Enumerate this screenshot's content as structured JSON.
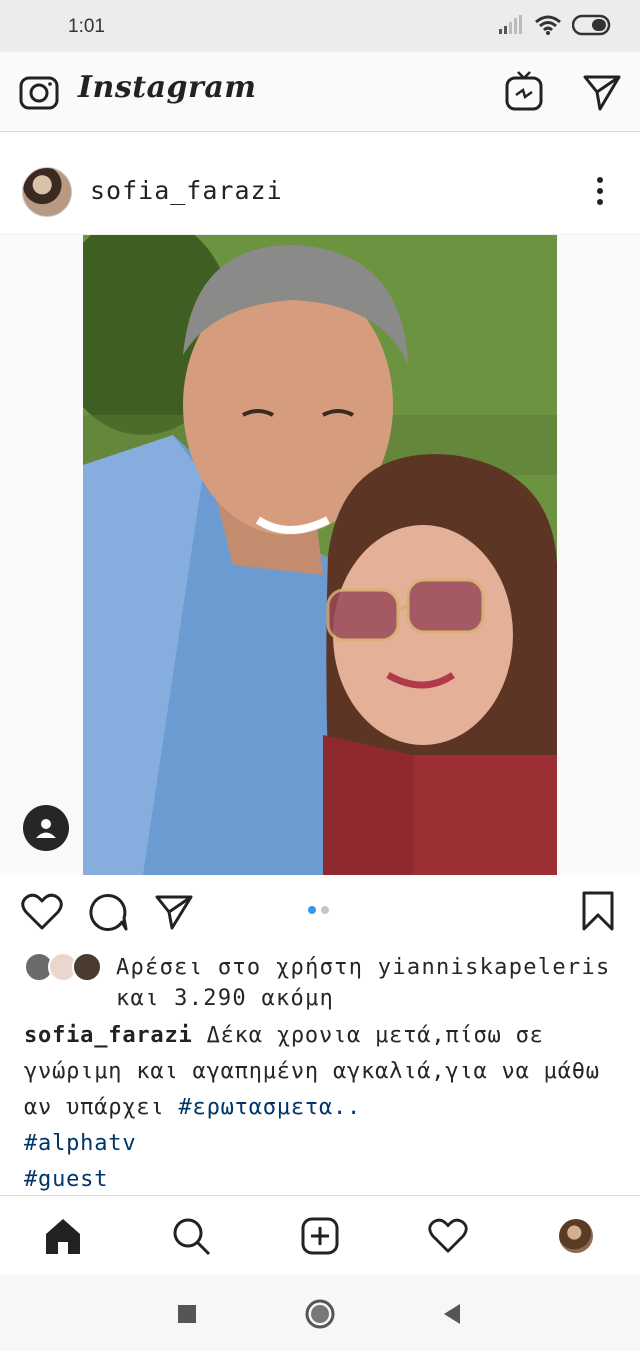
{
  "status_bar": {
    "time": "1:01"
  },
  "app": {
    "title": "Instagram"
  },
  "post": {
    "username": "sofia_farazi",
    "likes_text": "Αρέσει στο χρήστη yianniskapeleris και 3.290 ακόμη",
    "caption": {
      "user": "sofia_farazi",
      "text": " Δέκα χρονια μετά,πίσω σε γνώριμη και αγαπημένη αγκαλιά,για να μάθω αν υπάρχει ",
      "tag1": "#ερωτασμετα..",
      "tag2": "#alphatv",
      "tag3": "#guest"
    }
  },
  "icons": {
    "camera": "camera-icon",
    "igtv": "igtv-icon",
    "direct": "send-icon",
    "like": "heart-icon",
    "comment": "comment-icon",
    "share": "send-icon",
    "save": "bookmark-icon",
    "home": "home-icon",
    "search": "search-icon",
    "add": "add-post-icon",
    "activity": "heart-icon"
  },
  "colors": {
    "link": "#003569",
    "dot_active": "#3897f0",
    "text": "#262626"
  }
}
